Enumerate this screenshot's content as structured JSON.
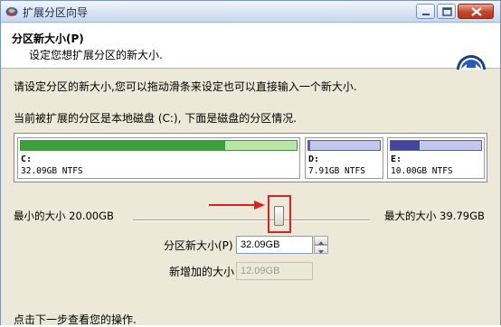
{
  "window": {
    "title": "扩展分区向导"
  },
  "header": {
    "title": "分区新大小(P)",
    "subtitle": "设定您想扩展分区的新大小."
  },
  "content": {
    "instruction": "请设定分区的新大小,您可以拖动滑条来设定也可以直接输入一个新大小.",
    "disk_info": "当前被扩展的分区是本地磁盘 (C:), 下面是磁盘的分区情况."
  },
  "partitions": [
    {
      "name": "C:",
      "info": "32.09GB NTFS",
      "used_fraction": 0.74
    },
    {
      "name": "D:",
      "info": "7.91GB NTFS",
      "used_fraction": 0.03
    },
    {
      "name": "E:",
      "info": "10.00GB NTFS",
      "used_fraction": 0.32
    }
  ],
  "slider": {
    "min_label": "最小的大小 20.00GB",
    "max_label": "最大的大小 39.79GB",
    "value_fraction": 0.61
  },
  "form": {
    "new_size_label": "分区新大小(P)",
    "new_size_value": "32.09GB",
    "added_label": "新增加的大小",
    "added_value": "12.09GB"
  },
  "footer": "点击下一步查看您的操作.",
  "colors": {
    "highlight": "#e02020",
    "c_used": "#3aa23a",
    "d_used": "#5a5fb8"
  },
  "icons": [
    "app-icon",
    "minimize-icon",
    "maximize-icon",
    "close-icon",
    "wizard-nav-icon",
    "arrow-icon"
  ]
}
